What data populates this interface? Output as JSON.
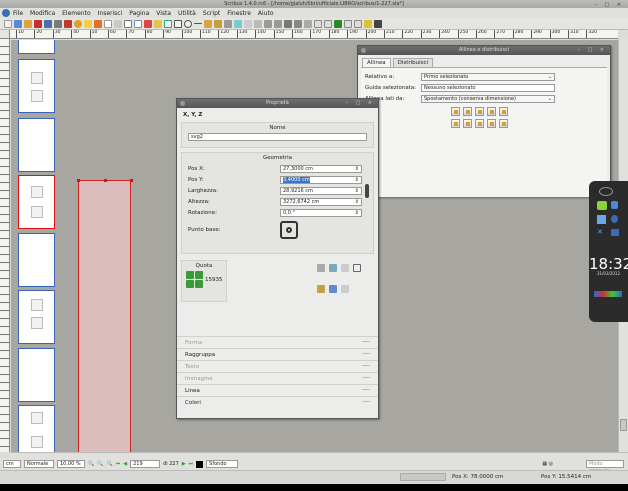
{
  "app": {
    "title": "Scribus 1.4.0.rc6 - [/home/gialuh/libri/ufficiale LIBRO/scribus/1-227.sla*]",
    "window_controls": [
      "minimize",
      "maximize",
      "close"
    ]
  },
  "menu": [
    "File",
    "Modifica",
    "Elemento",
    "Inserisci",
    "Pagina",
    "Vista",
    "Utilità",
    "Script",
    "Finestre",
    "Aiuto"
  ],
  "ruler_h_ticks": [
    "10",
    "20",
    "30",
    "40",
    "50",
    "60",
    "70",
    "80",
    "90",
    "100",
    "110",
    "120",
    "130",
    "140",
    "150",
    "160",
    "170",
    "180",
    "190",
    "200",
    "210",
    "220",
    "230",
    "240",
    "250",
    "260",
    "270",
    "280",
    "290",
    "300",
    "310",
    "320"
  ],
  "align_window": {
    "tabs": [
      "Allinea",
      "Distribuisci"
    ],
    "relative_label": "Relativo a:",
    "relative_value": "Primo selezionato",
    "guide_label": "Guida selezionata:",
    "guide_value": "Nessuno selezionato",
    "sides_label": "Allinea lati da:",
    "sides_value": "Spostamento (conserva dimensione)"
  },
  "properties": {
    "title": "Proprietà",
    "tab_xyz": "X, Y, Z",
    "name_section": "Nome",
    "name_value": "svg2",
    "geometry_section": "Geometria",
    "fields": [
      {
        "label": "Pos X:",
        "value": "27,3000 cm"
      },
      {
        "label": "Pos Y:",
        "value": "3,4000 cm"
      },
      {
        "label": "Larghezza:",
        "value": "28,9216 cm"
      },
      {
        "label": "Altezza:",
        "value": "3272,6742 cm"
      },
      {
        "label": "Rotazione:",
        "value": "0,0 °"
      }
    ],
    "basepoint_label": "Punto base:",
    "level_section": "Quota",
    "level_value": "15935",
    "collapsed_sections": [
      "Forma",
      "Raggruppa",
      "Testo",
      "Immagine",
      "Linea",
      "Colori"
    ]
  },
  "dock": {
    "clock": "18:32",
    "date": "31/03/2012"
  },
  "statusbar": {
    "unit": "cm",
    "mode": "Normale",
    "zoom": "10,00 %",
    "page": "219",
    "page_of": "di 227",
    "layer": "Sfondo",
    "preview": "Modo normale"
  },
  "coords": {
    "x": "Pos X: 78.0000 cm",
    "y": "Pos Y: 15.5414 cm"
  }
}
